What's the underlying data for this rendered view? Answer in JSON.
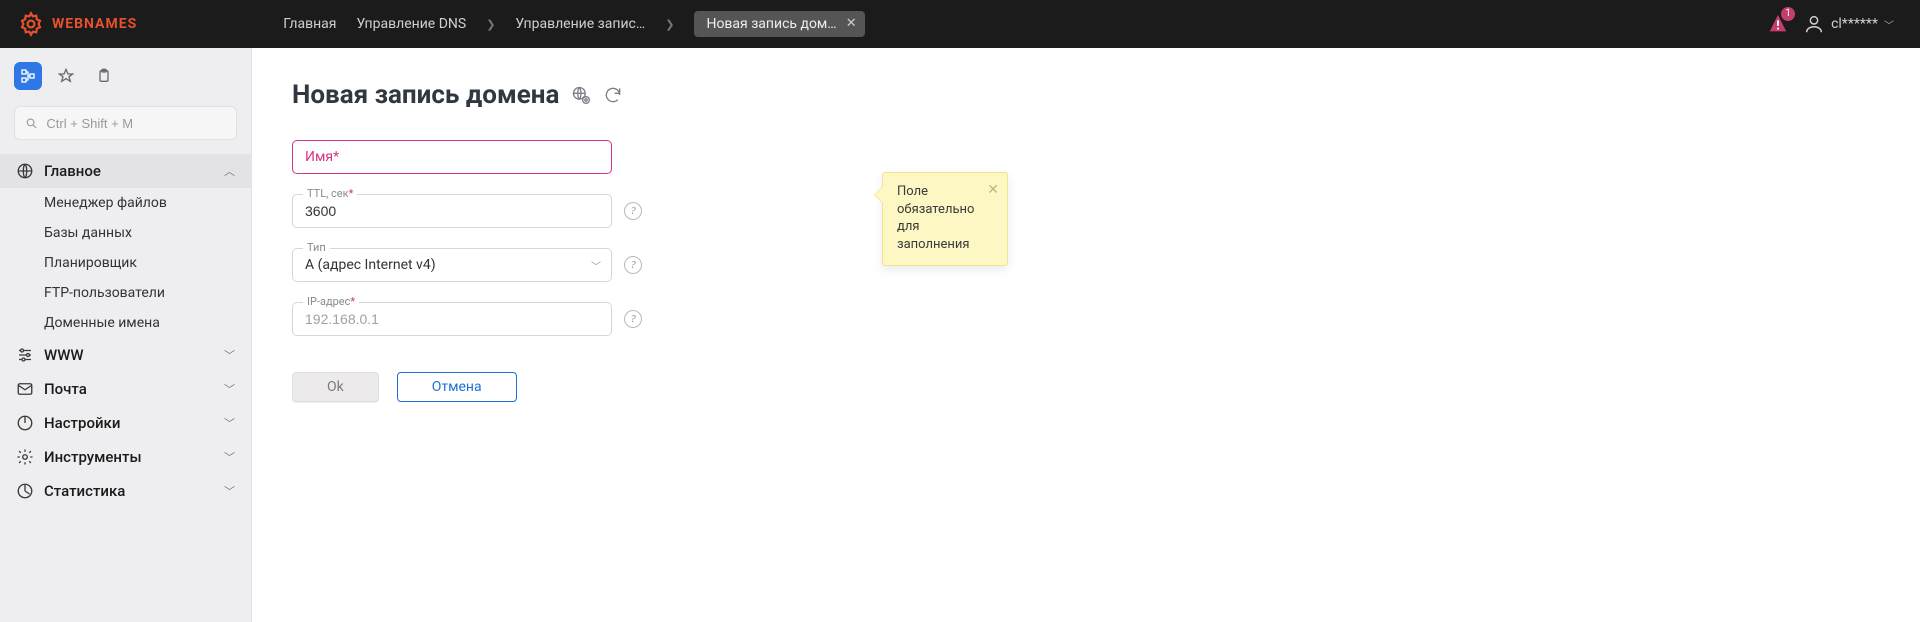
{
  "brand": {
    "name": "WEBNAMES"
  },
  "header": {
    "breadcrumbs": [
      {
        "label": "Главная"
      },
      {
        "label": "Управление DNS"
      },
      {
        "label": "Управление запис…"
      },
      {
        "label": "Новая запись дом…",
        "active": true
      }
    ],
    "notifications_count": "1",
    "user_label": "cl******"
  },
  "sidebar": {
    "search_placeholder": "Ctrl + Shift + M",
    "groups": [
      {
        "label": "Главное",
        "expanded": true,
        "children": [
          {
            "label": "Менеджер файлов"
          },
          {
            "label": "Базы данных"
          },
          {
            "label": "Планировщик"
          },
          {
            "label": "FTP-пользователи"
          },
          {
            "label": "Доменные имена"
          }
        ]
      },
      {
        "label": "WWW",
        "expanded": false
      },
      {
        "label": "Почта",
        "expanded": false
      },
      {
        "label": "Настройки",
        "expanded": false
      },
      {
        "label": "Инструменты",
        "expanded": false
      },
      {
        "label": "Статистика",
        "expanded": false
      }
    ]
  },
  "page": {
    "title": "Новая запись домена",
    "fields": {
      "name": {
        "label": "Имя",
        "required": true,
        "value": ""
      },
      "ttl": {
        "label": "TTL, сек",
        "required": true,
        "value": "3600"
      },
      "type": {
        "label": "Тип",
        "value": "A (адрес Internet v4)"
      },
      "ip": {
        "label": "IP-адрес",
        "required": true,
        "placeholder": "192.168.0.1",
        "value": ""
      }
    },
    "tooltip_required": "Поле обязательно для заполнения",
    "buttons": {
      "ok": "Ok",
      "cancel": "Отмена"
    }
  }
}
